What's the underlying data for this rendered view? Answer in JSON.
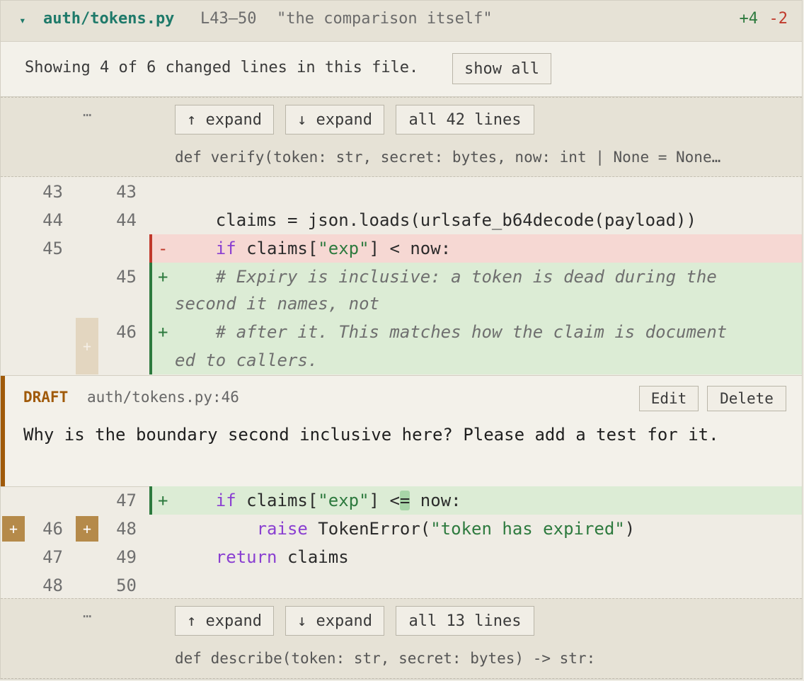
{
  "file": {
    "caret": "▾",
    "path": "auth/tokens.py",
    "range": "L43–50",
    "quote": "\"the comparison itself\"",
    "additions": "+4",
    "deletions": "-2"
  },
  "notice": {
    "text": "Showing 4 of 6 changed lines in this file.",
    "show_all_label": "show all"
  },
  "hunk_top": {
    "ellipsis": "⋯",
    "expand_up": "↑ expand",
    "expand_down": "↓ expand",
    "all_lines": "all 42 lines",
    "signature": "def verify(token: str, secret: bytes, now: int | None = None…"
  },
  "hunk_bottom": {
    "ellipsis": "⋯",
    "expand_up": "↑ expand",
    "expand_down": "↓ expand",
    "all_lines": "all 13 lines",
    "signature": "def describe(token: str, secret: bytes) -> str:"
  },
  "lines": {
    "l1": {
      "old": "43",
      "new": "43"
    },
    "l2": {
      "old": "44",
      "new": "44",
      "code": "    claims = json.loads(urlsafe_b64decode(payload))"
    },
    "l3": {
      "old": "45",
      "marker": "-",
      "indent": "    ",
      "kw": "if",
      "pre": " claims[",
      "str": "\"exp\"",
      "post": "] < now:"
    },
    "l4": {
      "new": "45",
      "marker": "+",
      "comment_a": "    # Expiry is inclusive: a token is dead during the",
      "comment_b": "second it names, not"
    },
    "l5": {
      "new": "46",
      "marker": "+",
      "comment_a": "    # after it. This matches how the claim is document",
      "comment_b": "ed to callers."
    },
    "l6": {
      "new": "47",
      "marker": "+",
      "indent": "    ",
      "kw": "if",
      "pre": " claims[",
      "str": "\"exp\"",
      "mid": "] <",
      "hl": "=",
      "post": " now:"
    },
    "l7": {
      "old": "46",
      "new": "48",
      "indent": "        ",
      "kw": "raise",
      "pre": " TokenError(",
      "str": "\"token has expired\"",
      "post": ")"
    },
    "l8": {
      "old": "47",
      "new": "49",
      "indent": "    ",
      "kw": "return",
      "post": " claims"
    },
    "l9": {
      "old": "48",
      "new": "50"
    }
  },
  "draft": {
    "label": "DRAFT",
    "location": "auth/tokens.py:46",
    "edit_label": "Edit",
    "delete_label": "Delete",
    "body": "Why is the boundary second inclusive here? Please add a test for it."
  },
  "gutter_plus": "+",
  "colors": {
    "accent": "#1f7a6a",
    "addition": "#2d7a3e",
    "deletion": "#c0392b",
    "draft": "#a05a0a",
    "keyword": "#8a3fd1"
  }
}
